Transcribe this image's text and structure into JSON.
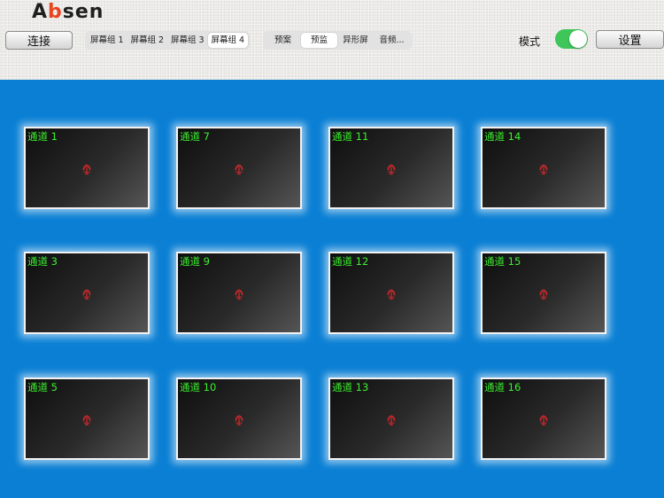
{
  "logo": {
    "text_a": "A",
    "text_b": "b",
    "text_rest": "sen"
  },
  "toolbar": {
    "connect_label": "连接",
    "settings_label": "设置",
    "mode_label": "模式",
    "mode_toggle_on": true,
    "accent_color": "#3ec65a"
  },
  "screen_groups": [
    {
      "label": "屏幕组 1",
      "active": false
    },
    {
      "label": "屏幕组 2",
      "active": false
    },
    {
      "label": "屏幕组 3",
      "active": false
    },
    {
      "label": "屏幕组 4",
      "active": true
    }
  ],
  "mode_tabs": [
    {
      "label": "预案",
      "active": false
    },
    {
      "label": "预监",
      "active": true
    },
    {
      "label": "异形屏",
      "active": false
    },
    {
      "label": "音频...",
      "active": false
    }
  ],
  "channels": [
    {
      "label": "通道 1"
    },
    {
      "label": "通道 7"
    },
    {
      "label": "通道 11"
    },
    {
      "label": "通道 14"
    },
    {
      "label": "通道 3"
    },
    {
      "label": "通道 9"
    },
    {
      "label": "通道 12"
    },
    {
      "label": "通道 15"
    },
    {
      "label": "通道 5"
    },
    {
      "label": "通道 10"
    },
    {
      "label": "通道 13"
    },
    {
      "label": "通道 16"
    }
  ],
  "colors": {
    "background": "#0a7fd4",
    "channel_label": "#3cf02e",
    "icon": "#c0282b"
  }
}
